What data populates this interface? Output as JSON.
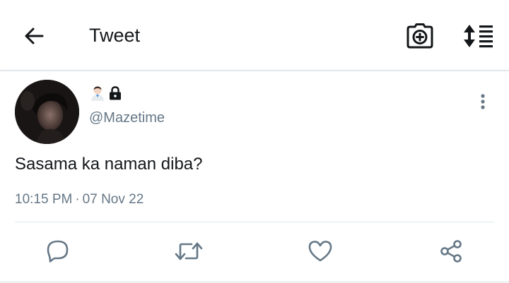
{
  "header": {
    "title": "Tweet",
    "back_icon": "arrow-left-icon",
    "camera_icon": "camera-plus-icon",
    "sort_icon": "sort-list-icon"
  },
  "tweet": {
    "display_name_icons": [
      "person-emoji-icon",
      "lock-icon"
    ],
    "handle": "@Mazetime",
    "text": "Sasama ka naman diba?",
    "time": "10:15 PM",
    "separator": "·",
    "date": "07 Nov 22"
  },
  "actions": [
    {
      "name": "reply",
      "icon": "reply-icon"
    },
    {
      "name": "retweet",
      "icon": "retweet-icon"
    },
    {
      "name": "like",
      "icon": "heart-icon"
    },
    {
      "name": "share",
      "icon": "share-icon"
    }
  ],
  "colors": {
    "text_primary": "#14171a",
    "text_secondary": "#657786",
    "icon_gray": "#657786",
    "divider": "#e1e8ed"
  }
}
